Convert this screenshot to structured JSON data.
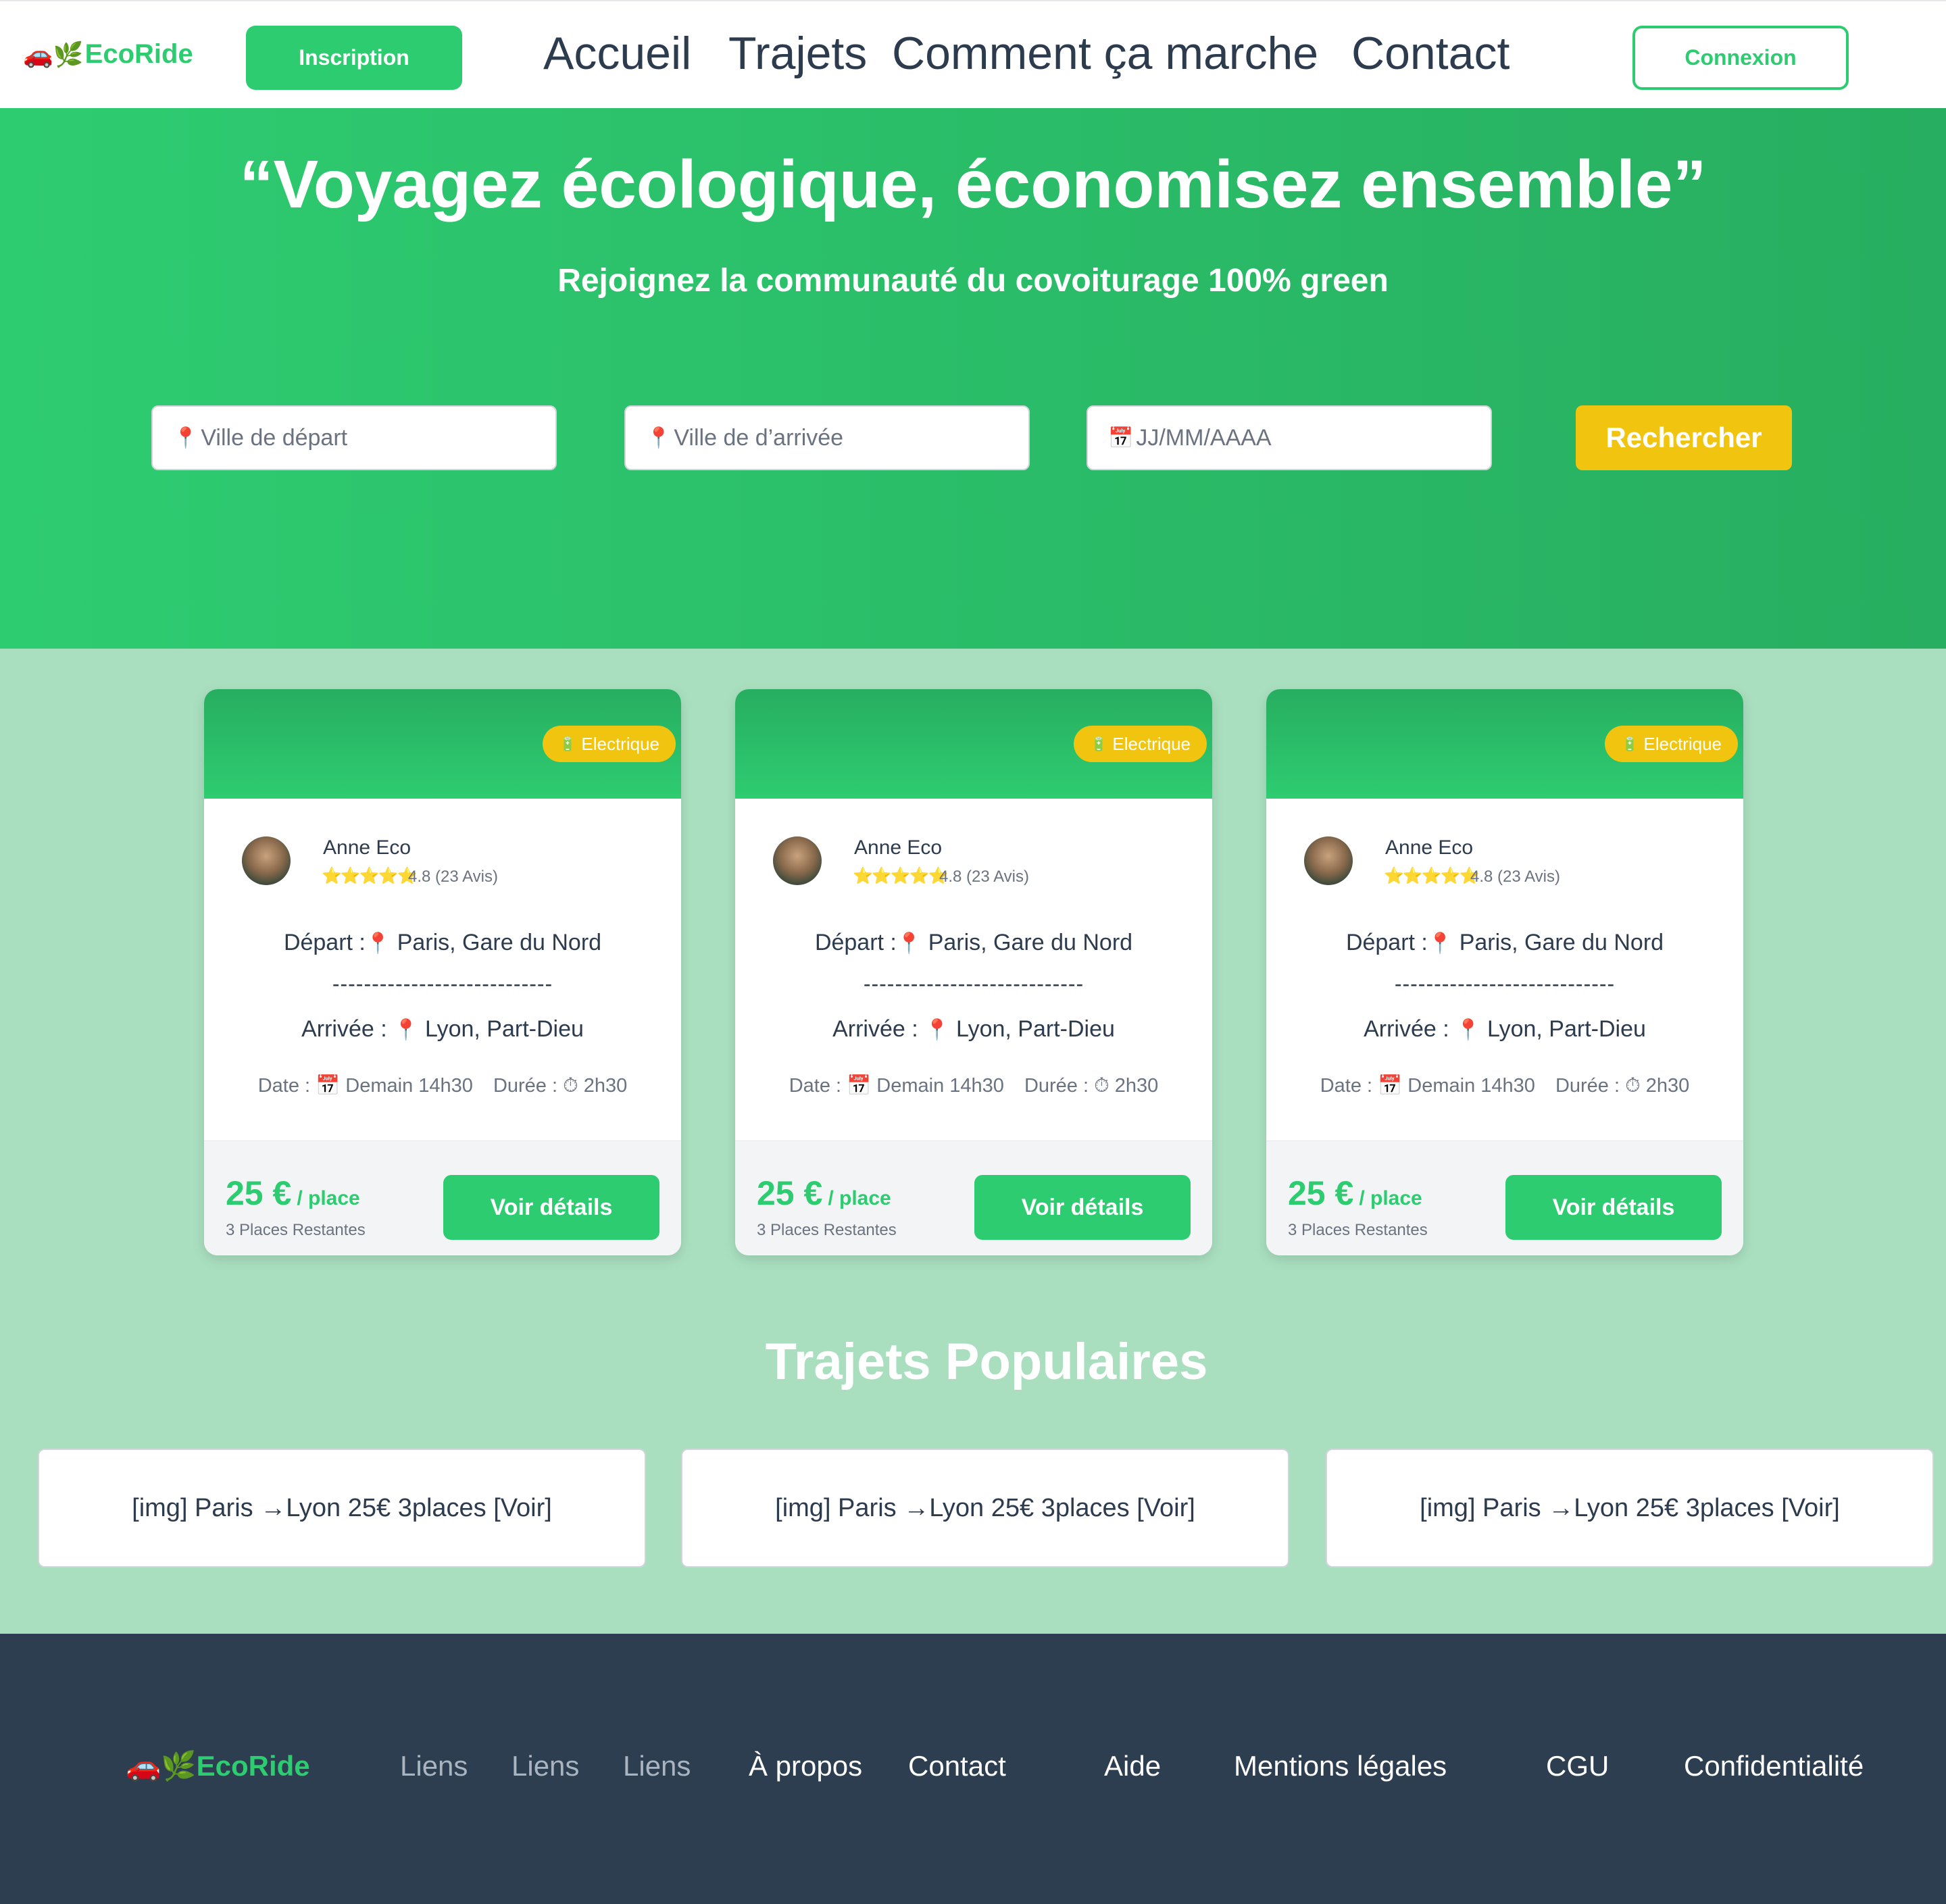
{
  "nav": {
    "logo_icon": "🚗🌿",
    "logo_text": "EcoRide",
    "inscription": "Inscription",
    "links": [
      "Accueil",
      "Trajets",
      "Comment ça marche",
      "Contact"
    ],
    "connexion": "Connexion"
  },
  "hero": {
    "title": "“Voyagez écologique, économisez ensemble”",
    "subtitle": "Rejoignez la communauté du covoiturage 100% green",
    "depart_placeholder": "Ville de départ",
    "arrivee_placeholder": "Ville de d’arrivée",
    "date_placeholder": "JJ/MM/AAAA",
    "search_button": "Rechercher"
  },
  "cards": [
    {
      "badge": "Electrique",
      "driver": "Anne Eco",
      "rating": "4.8 (23 Avis)",
      "stars": 5,
      "depart_label": "Départ :",
      "depart_value": "Paris, Gare du Nord",
      "separator": "----------------------------",
      "arrivee_label": "Arrivée :",
      "arrivee_value": "Lyon, Part-Dieu",
      "date_label": "Date :",
      "date_value": "Demain 14h30",
      "duree_label": "Durée :",
      "duree_value": "2h30",
      "price": "25 €",
      "per_place": "/ place",
      "remaining": "3 Places Restantes",
      "button": "Voir détails"
    },
    {
      "badge": "Electrique",
      "driver": "Anne Eco",
      "rating": "4.8 (23 Avis)",
      "stars": 5,
      "depart_label": "Départ :",
      "depart_value": "Paris, Gare du Nord",
      "separator": "----------------------------",
      "arrivee_label": "Arrivée :",
      "arrivee_value": "Lyon, Part-Dieu",
      "date_label": "Date :",
      "date_value": "Demain 14h30",
      "duree_label": "Durée :",
      "duree_value": "2h30",
      "price": "25 €",
      "per_place": "/ place",
      "remaining": "3 Places Restantes",
      "button": "Voir détails"
    },
    {
      "badge": "Electrique",
      "driver": "Anne Eco",
      "rating": "4.8 (23 Avis)",
      "stars": 5,
      "depart_label": "Départ :",
      "depart_value": "Paris, Gare du Nord",
      "separator": "----------------------------",
      "arrivee_label": "Arrivée :",
      "arrivee_value": "Lyon, Part-Dieu",
      "date_label": "Date :",
      "date_value": "Demain 14h30",
      "duree_label": "Durée :",
      "duree_value": "2h30",
      "price": "25 €",
      "per_place": "/ place",
      "remaining": "3 Places Restantes",
      "button": "Voir détails"
    }
  ],
  "popular": {
    "title": "Trajets Populaires",
    "items": [
      "[img]  Paris →Lyon   25€  3places  [Voir]",
      "[img]  Paris →Lyon   25€  3places  [Voir]",
      "[img]  Paris →Lyon   25€  3places  [Voir]"
    ]
  },
  "footer": {
    "logo_icon": "🚗🌿",
    "logo_text": "EcoRide",
    "links_muted": [
      "Liens",
      "Liens",
      "Liens"
    ],
    "links": [
      "À propos",
      "Contact",
      "Aide",
      "Mentions légales",
      "CGU",
      "Confidentialité"
    ]
  },
  "colors": {
    "brand_green": "#2ecc71",
    "dark_green": "#27ae60",
    "accent_yellow": "#f1c40f",
    "light_green_bg": "#a9dfbf",
    "footer_bg": "#2c3e50"
  }
}
